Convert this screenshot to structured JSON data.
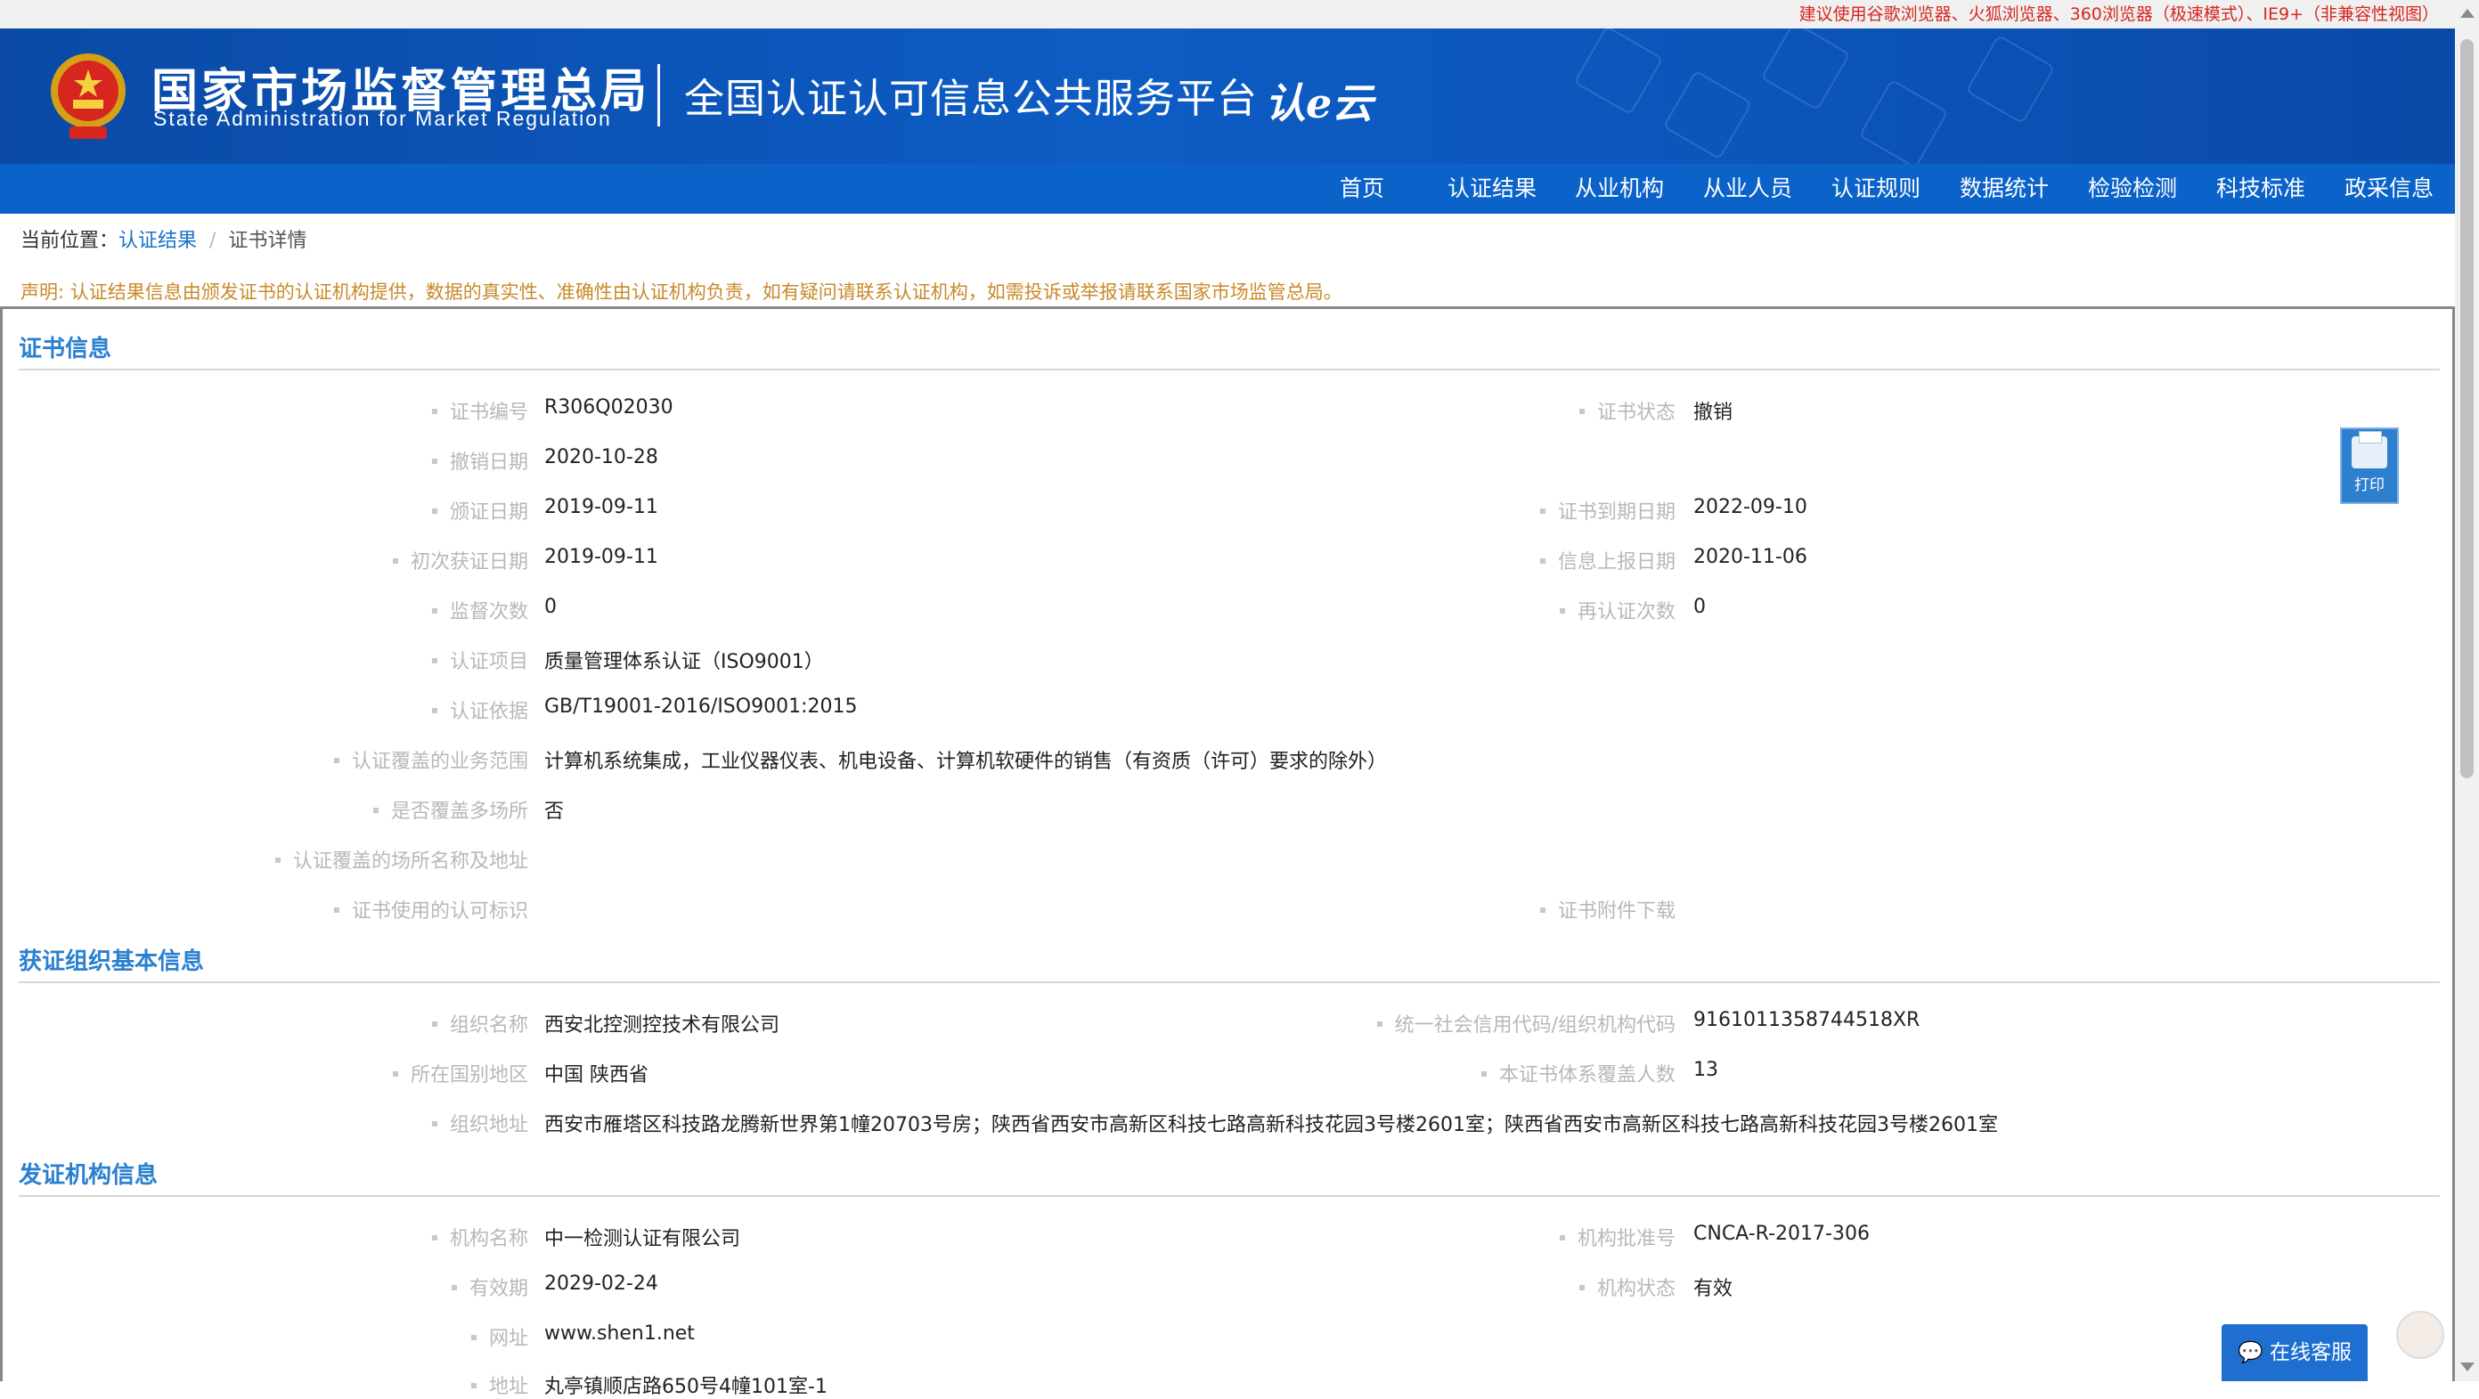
{
  "top_notice": "建议使用谷歌浏览器、火狐浏览器、360浏览器（极速模式）、IE9+（非兼容性视图）",
  "header": {
    "org_name_cn": "国家市场监督管理总局",
    "org_name_en": "State Administration for Market Regulation",
    "platform_name": "全国认证认可信息公共服务平台",
    "logo_text": "认e云"
  },
  "nav": [
    "首页",
    "认证结果",
    "从业机构",
    "从业人员",
    "认证规则",
    "数据统计",
    "检验检测",
    "科技标准",
    "政采信息"
  ],
  "breadcrumb": {
    "prefix": "当前位置：",
    "link": "认证结果",
    "separator": "/",
    "current": "证书详情"
  },
  "statement": "声明: 认证结果信息由颁发证书的认证机构提供，数据的真实性、准确性由认证机构负责，如有疑问请联系认证机构，如需投诉或举报请联系国家市场监管总局。",
  "cert_section": {
    "title": "证书信息",
    "fields": {
      "cert_no": {
        "label": "证书编号",
        "value": "R306Q02030"
      },
      "cert_status": {
        "label": "证书状态",
        "value": "撤销"
      },
      "revoke_date": {
        "label": "撤销日期",
        "value": "2020-10-28"
      },
      "issue_date": {
        "label": "颁证日期",
        "value": "2019-09-11"
      },
      "expire_date": {
        "label": "证书到期日期",
        "value": "2022-09-10"
      },
      "first_date": {
        "label": "初次获证日期",
        "value": "2019-09-11"
      },
      "report_date": {
        "label": "信息上报日期",
        "value": "2020-11-06"
      },
      "supervise_count": {
        "label": "监督次数",
        "value": "0"
      },
      "recert_count": {
        "label": "再认证次数",
        "value": "0"
      },
      "project": {
        "label": "认证项目",
        "value": "质量管理体系认证（ISO9001）"
      },
      "basis": {
        "label": "认证依据",
        "value": "GB/T19001-2016/ISO9001:2015"
      },
      "scope": {
        "label": "认证覆盖的业务范围",
        "value": "计算机系统集成，工业仪器仪表、机电设备、计算机软硬件的销售（有资质（许可）要求的除外）"
      },
      "multi_site": {
        "label": "是否覆盖多场所",
        "value": "否"
      },
      "site_address": {
        "label": "认证覆盖的场所名称及地址",
        "value": ""
      },
      "mark": {
        "label": "证书使用的认可标识",
        "value": ""
      },
      "attachment": {
        "label": "证书附件下载",
        "value": ""
      }
    }
  },
  "org_section": {
    "title": "获证组织基本信息",
    "fields": {
      "org_name": {
        "label": "组织名称",
        "value": "西安北控测控技术有限公司"
      },
      "credit_code": {
        "label": "统一社会信用代码/组织机构代码",
        "value": "9161011358744518XR"
      },
      "region": {
        "label": "所在国别地区",
        "value": "中国 陕西省"
      },
      "headcount": {
        "label": "本证书体系覆盖人数",
        "value": "13"
      },
      "address": {
        "label": "组织地址",
        "value": "西安市雁塔区科技路龙腾新世界第1幢20703号房；陕西省西安市高新区科技七路高新科技花园3号楼2601室；陕西省西安市高新区科技七路高新科技花园3号楼2601室"
      }
    }
  },
  "issuer_section": {
    "title": "发证机构信息",
    "fields": {
      "name": {
        "label": "机构名称",
        "value": "中一检测认证有限公司"
      },
      "approval_no": {
        "label": "机构批准号",
        "value": "CNCA-R-2017-306"
      },
      "valid_until": {
        "label": "有效期",
        "value": "2029-02-24"
      },
      "status": {
        "label": "机构状态",
        "value": "有效"
      },
      "website": {
        "label": "网址",
        "value": "www.shen1.net"
      },
      "address": {
        "label": "地址",
        "value": "丸亭镇顺店路650号4幢101室-1"
      }
    }
  },
  "print_label": "打印",
  "chat_label": "在线客服",
  "colors": {
    "brand_blue": "#0b62c9",
    "section_blue": "#2a80d0",
    "notice_red": "#d6261f",
    "statement_orange": "#c88a2a"
  }
}
